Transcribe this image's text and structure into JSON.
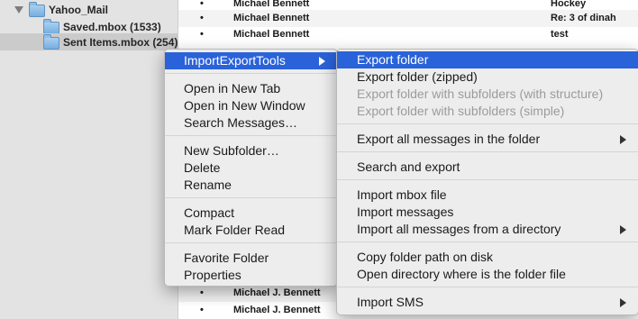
{
  "sidebar": {
    "account": "Yahoo_Mail",
    "folders": [
      "Saved.mbox (1533)",
      "Sent Items.mbox (254)"
    ]
  },
  "messages": {
    "bullet": "•",
    "rows": [
      {
        "sender": "Michael Bennett",
        "subject": "Hockey"
      },
      {
        "sender": "Michael Bennett",
        "subject": "Re: 3 of dinah"
      },
      {
        "sender": "Michael Bennett",
        "subject": "test"
      },
      {
        "sender": "Michael J. Bennett",
        "subject": ""
      },
      {
        "sender": "Michael J. Bennett",
        "subject": ""
      }
    ]
  },
  "context_menu": {
    "items": [
      "ImportExportTools",
      "Open in New Tab",
      "Open in New Window",
      "Search Messages…",
      "New Subfolder…",
      "Delete",
      "Rename",
      "Compact",
      "Mark Folder Read",
      "Favorite Folder",
      "Properties"
    ]
  },
  "submenu": {
    "items": [
      "Export folder",
      "Export folder (zipped)",
      "Export folder with subfolders (with structure)",
      "Export folder with subfolders (simple)",
      "Export all messages in the folder",
      "Search and export",
      "Import mbox file",
      "Import messages",
      "Import all messages from a directory",
      "Copy folder path on disk",
      "Open directory where is the folder file",
      "Import SMS"
    ]
  },
  "colors": {
    "highlight": "#2a62d9",
    "sidebar_bg": "#e3e3e3",
    "folder_icon": "#76aee0"
  }
}
